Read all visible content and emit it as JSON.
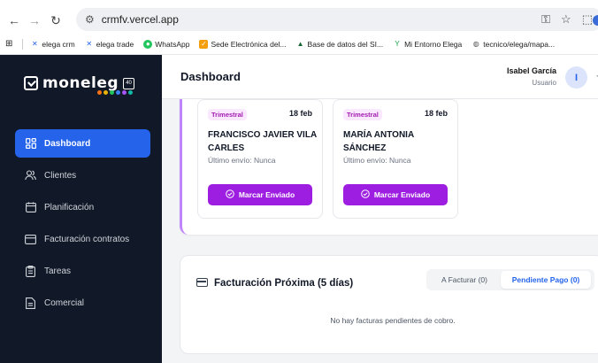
{
  "browser": {
    "url": "crmfv.vercel.app",
    "bookmarks": [
      {
        "label": "elega crm",
        "icon": "arrow-logo-icon",
        "color": "#2563eb"
      },
      {
        "label": "elega trade",
        "icon": "arrow-logo-icon",
        "color": "#2563eb"
      },
      {
        "label": "WhatsApp",
        "icon": "whatsapp-icon",
        "color": "#22c55e"
      },
      {
        "label": "Sede Electrónica del...",
        "icon": "sede-icon",
        "color": "#f59e0b"
      },
      {
        "label": "Base de datos del SI...",
        "icon": "base-datos-icon",
        "color": "#166534"
      },
      {
        "label": "Mi Entorno Elega",
        "icon": "entorno-icon",
        "color": "#16a34a"
      },
      {
        "label": "tecnico/elega/mapa...",
        "icon": "globe-icon",
        "color": "#555555"
      }
    ]
  },
  "app": {
    "logo_text": "moneleg",
    "logo_badge": "40",
    "header": {
      "title": "Dashboard",
      "user_name": "Isabel García",
      "user_role": "Usuario",
      "avatar_initial": "I"
    },
    "sidebar": {
      "items": [
        {
          "label": "Dashboard",
          "icon": "dashboard-icon",
          "active": true
        },
        {
          "label": "Clientes",
          "icon": "users-icon",
          "active": false
        },
        {
          "label": "Planificación",
          "icon": "calendar-icon",
          "active": false
        },
        {
          "label": "Facturación contratos",
          "icon": "card-icon",
          "active": false
        },
        {
          "label": "Tareas",
          "icon": "clipboard-icon",
          "active": false
        },
        {
          "label": "Comercial",
          "icon": "document-icon",
          "active": false
        }
      ]
    },
    "reminders": [
      {
        "tag": "Trimestral",
        "date": "18 feb",
        "name": "FRANCISCO JAVIER VILA CARLES",
        "last_sent": "Último envío: Nunca",
        "button": "Marcar Enviado"
      },
      {
        "tag": "Trimestral",
        "date": "18 feb",
        "name": "MARÍA ANTONIA SÁNCHEZ",
        "last_sent": "Último envío: Nunca",
        "button": "Marcar Enviado"
      }
    ],
    "billing": {
      "title": "Facturación Próxima (5 días)",
      "tabs": [
        "A Facturar (0)",
        "Pendiente Pago (0)"
      ],
      "active_tab": 1,
      "empty_message": "No hay facturas pendientes de cobro."
    },
    "colors": {
      "sidebar_bg": "#111827",
      "active_nav": "#2563eb",
      "button_purple": "#9d1de0",
      "panel_accent": "#c084fc"
    }
  }
}
